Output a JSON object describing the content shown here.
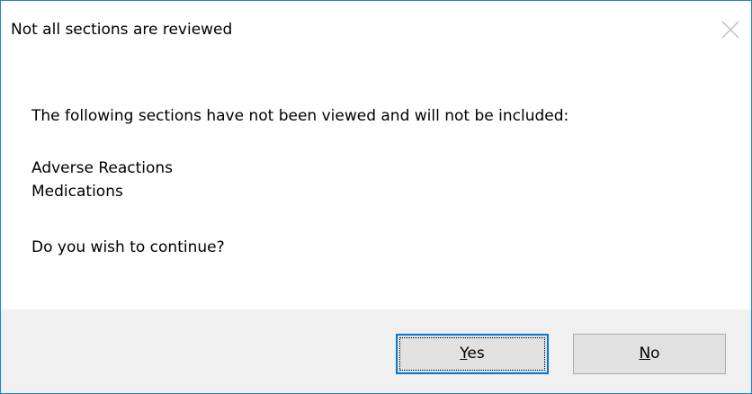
{
  "dialog": {
    "title": "Not all sections are reviewed",
    "message": {
      "intro": "The following sections have not been viewed and will not be included:",
      "sections": [
        "Adverse Reactions",
        "Medications"
      ],
      "question": "Do you wish to continue?"
    },
    "buttons": {
      "yes": {
        "mnemonic": "Y",
        "rest": "es"
      },
      "no": {
        "mnemonic": "N",
        "rest": "o"
      }
    }
  },
  "icons": {
    "close": "close-icon"
  },
  "colors": {
    "accent_border": "#1883d7",
    "footer_bg": "#f0f0f0",
    "button_bg": "#e1e1e1",
    "focus_border": "#0078d7"
  }
}
